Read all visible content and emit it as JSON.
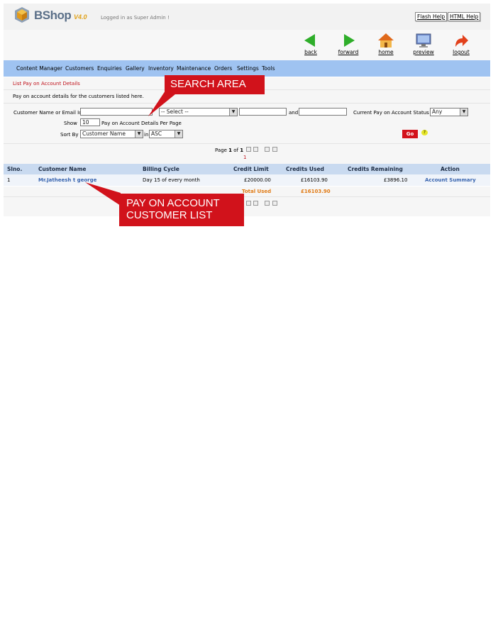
{
  "app": {
    "logo_text": "BShop",
    "version": "V4.0",
    "logged_in": "Logged in as Super Admin !",
    "flash_help": "Flash Help",
    "html_help": "HTML Help"
  },
  "toolbar": {
    "back": "back",
    "forward": "forward",
    "home": "home",
    "preview": "preview",
    "logout": "logout"
  },
  "menu": [
    "Content Manager",
    "Customers",
    "Enquiries",
    "Gallery",
    "Inventory",
    "Maintenance",
    "Orders",
    "Settings",
    "Tools"
  ],
  "page": {
    "title": "List Pay on Account Details",
    "description": "Pay on account details for the customers listed here."
  },
  "search": {
    "name_label": "Customer Name or Email Id",
    "name_value": "",
    "select_value": "-- Select --",
    "from_value": "",
    "and_label": "and",
    "to_value": "",
    "status_label": "Current Pay on Account Status",
    "status_value": "Any",
    "show_label": "Show",
    "show_value": "10",
    "per_page_label": "Pay on Account Details Per Page",
    "sort_label": "Sort By",
    "sort_value": "Customer Name",
    "in_label": "in",
    "order_value": "ASC",
    "go_label": "Go",
    "help_glyph": "?"
  },
  "pager": {
    "text_prefix": "Page ",
    "current": "1",
    "text_mid": " of ",
    "total": "1",
    "page_link": "1"
  },
  "table": {
    "headers": {
      "slno": "Slno.",
      "name": "Customer Name",
      "cycle": "Billing Cycle",
      "limit": "Credit Limit",
      "used": "Credits Used",
      "remaining": "Credits Remaining",
      "action": "Action"
    },
    "rows": [
      {
        "slno": "1",
        "name": "Mr.Jatheesh t george",
        "cycle": "Day 15 of every month",
        "limit": "£20000.00",
        "used": "£16103.90",
        "remaining": "£3896.10",
        "action": "Account Summary"
      }
    ],
    "total_label": "Total Used",
    "total_value": "£16103.90"
  },
  "callouts": {
    "search": "SEARCH AREA",
    "list_line1": "PAY ON ACCOUNT",
    "list_line2": "CUSTOMER LIST"
  },
  "colors": {
    "menu_bar": "#9fc3f1",
    "table_header": "#c9daf0",
    "callout": "#d1121b",
    "link": "#3a66b0",
    "total": "#e07a14"
  }
}
